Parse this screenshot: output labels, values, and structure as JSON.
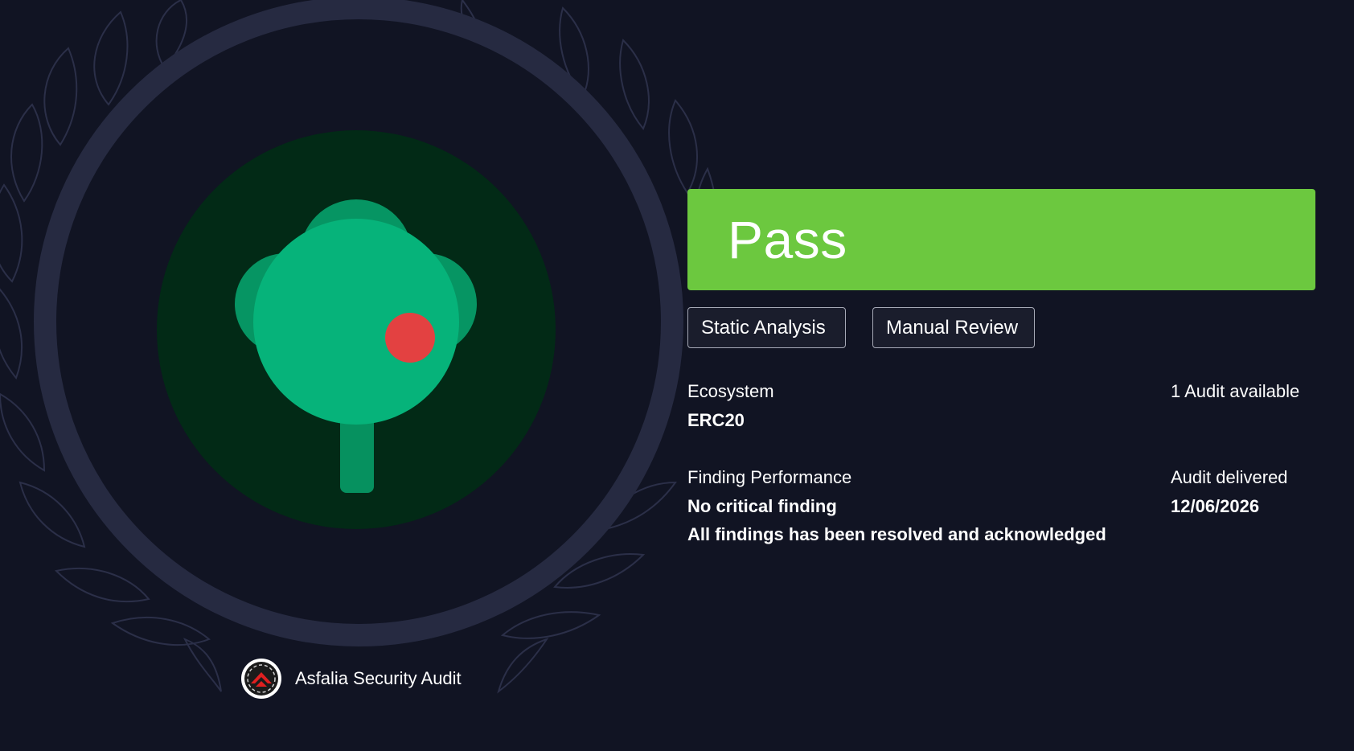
{
  "status": {
    "label": "Pass",
    "color": "#6cc83f"
  },
  "tags": {
    "static_analysis": "Static Analysis",
    "manual_review": "Manual Review"
  },
  "ecosystem": {
    "label": "Ecosystem",
    "value": "ERC20"
  },
  "audit_count": {
    "label": "1 Audit available"
  },
  "finding_performance": {
    "label": "Finding Performance",
    "line1": "No critical finding",
    "line2": "All findings has been resolved and acknowledged"
  },
  "audit_delivered": {
    "label": "Audit delivered",
    "date": "12/06/2026"
  },
  "brand": {
    "name": "Asfalia Security Audit",
    "logo_icon": "asfalia-logo-icon"
  },
  "badge": {
    "icon": "tree-icon",
    "circle_color": "#022a16",
    "tree_color": "#06b37a",
    "marker_color": "#e34141",
    "ring_color": "#2a2d45"
  }
}
